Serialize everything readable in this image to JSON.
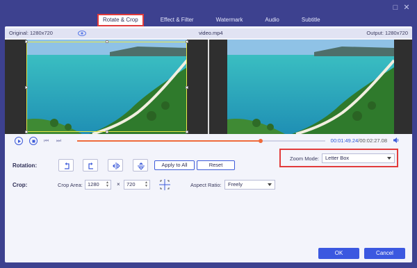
{
  "tabs": [
    {
      "label": "Rotate & Crop",
      "active": true
    },
    {
      "label": "Effect & Filter",
      "active": false
    },
    {
      "label": "Watermark",
      "active": false
    },
    {
      "label": "Audio",
      "active": false
    },
    {
      "label": "Subtitle",
      "active": false
    }
  ],
  "window": {
    "maximize_icon": "□",
    "close_icon": "✕"
  },
  "infobar": {
    "original": "Original: 1280x720",
    "filename": "video.mp4",
    "output": "Output: 1280x720"
  },
  "player": {
    "current_time": "00:01:49.24",
    "total_time": "/00:02:27.08",
    "progress": 0.74
  },
  "rotation": {
    "label": "Rotation:",
    "apply_all": "Apply to All",
    "reset": "Reset"
  },
  "crop": {
    "label": "Crop:",
    "area_label": "Crop Area:",
    "width": "1280",
    "times": "×",
    "height": "720",
    "aspect_label": "Aspect Ratio:",
    "aspect_value": "Freely",
    "zoom_label": "Zoom Mode:",
    "zoom_value": "Letter Box"
  },
  "footer": {
    "ok": "OK",
    "cancel": "Cancel"
  },
  "colors": {
    "accent": "#3b58e0",
    "highlight": "#e23b3b",
    "progress": "#ef6a3a",
    "window": "#3d418f"
  }
}
